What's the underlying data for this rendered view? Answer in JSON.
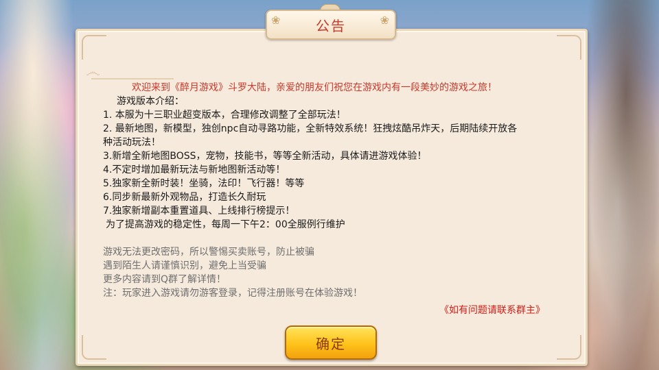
{
  "dialog": {
    "title": "公告",
    "welcome": "欢迎来到《醉月游戏》斗罗大陆，亲爱的朋友们祝您在游戏内有一段美妙的游戏之旅！",
    "intro_title": "游戏版本介绍：",
    "items": [
      "1. 本服为十三职业超变版本，合理修改调整了全部玩法！",
      "2. 最新地图，新模型，独创npc自动寻路功能，全新特效系统！狂拽炫酷吊炸天，后期陆续开放各",
      "种活动玩法！",
      "3.新增全新地图BOSS，宠物，技能书，等等全新活动，具体请进游戏体验！",
      "4.不定时增加最新玩法与新地图新活动等！",
      "5.独家新全新时装！坐骑，法印！飞行器！等等",
      "6.同步新最新外观物品，打造长久耐玩",
      "7.独家新增副本重置道具、上线排行榜提示！"
    ],
    "maintenance": "为了提高游戏的稳定性，每周一下午2：00全服例行维护",
    "warnings": [
      "游戏无法更改密码，所以警惕买卖账号，防止被骗",
      "遇到陌生人请谨慎识别，避免上当受骗",
      "更多内容请到Q群了解详情！",
      "注：玩家进入游戏请勿游客登录，记得注册账号在体验游戏！"
    ],
    "contact": "《如有问题请联系群主》",
    "confirm_label": "确定"
  },
  "colors": {
    "title": "#c8392b",
    "welcome": "#c8392b",
    "warning_text": "#6e6e6e",
    "contact": "#d11d16",
    "button": "#ffc21a"
  }
}
